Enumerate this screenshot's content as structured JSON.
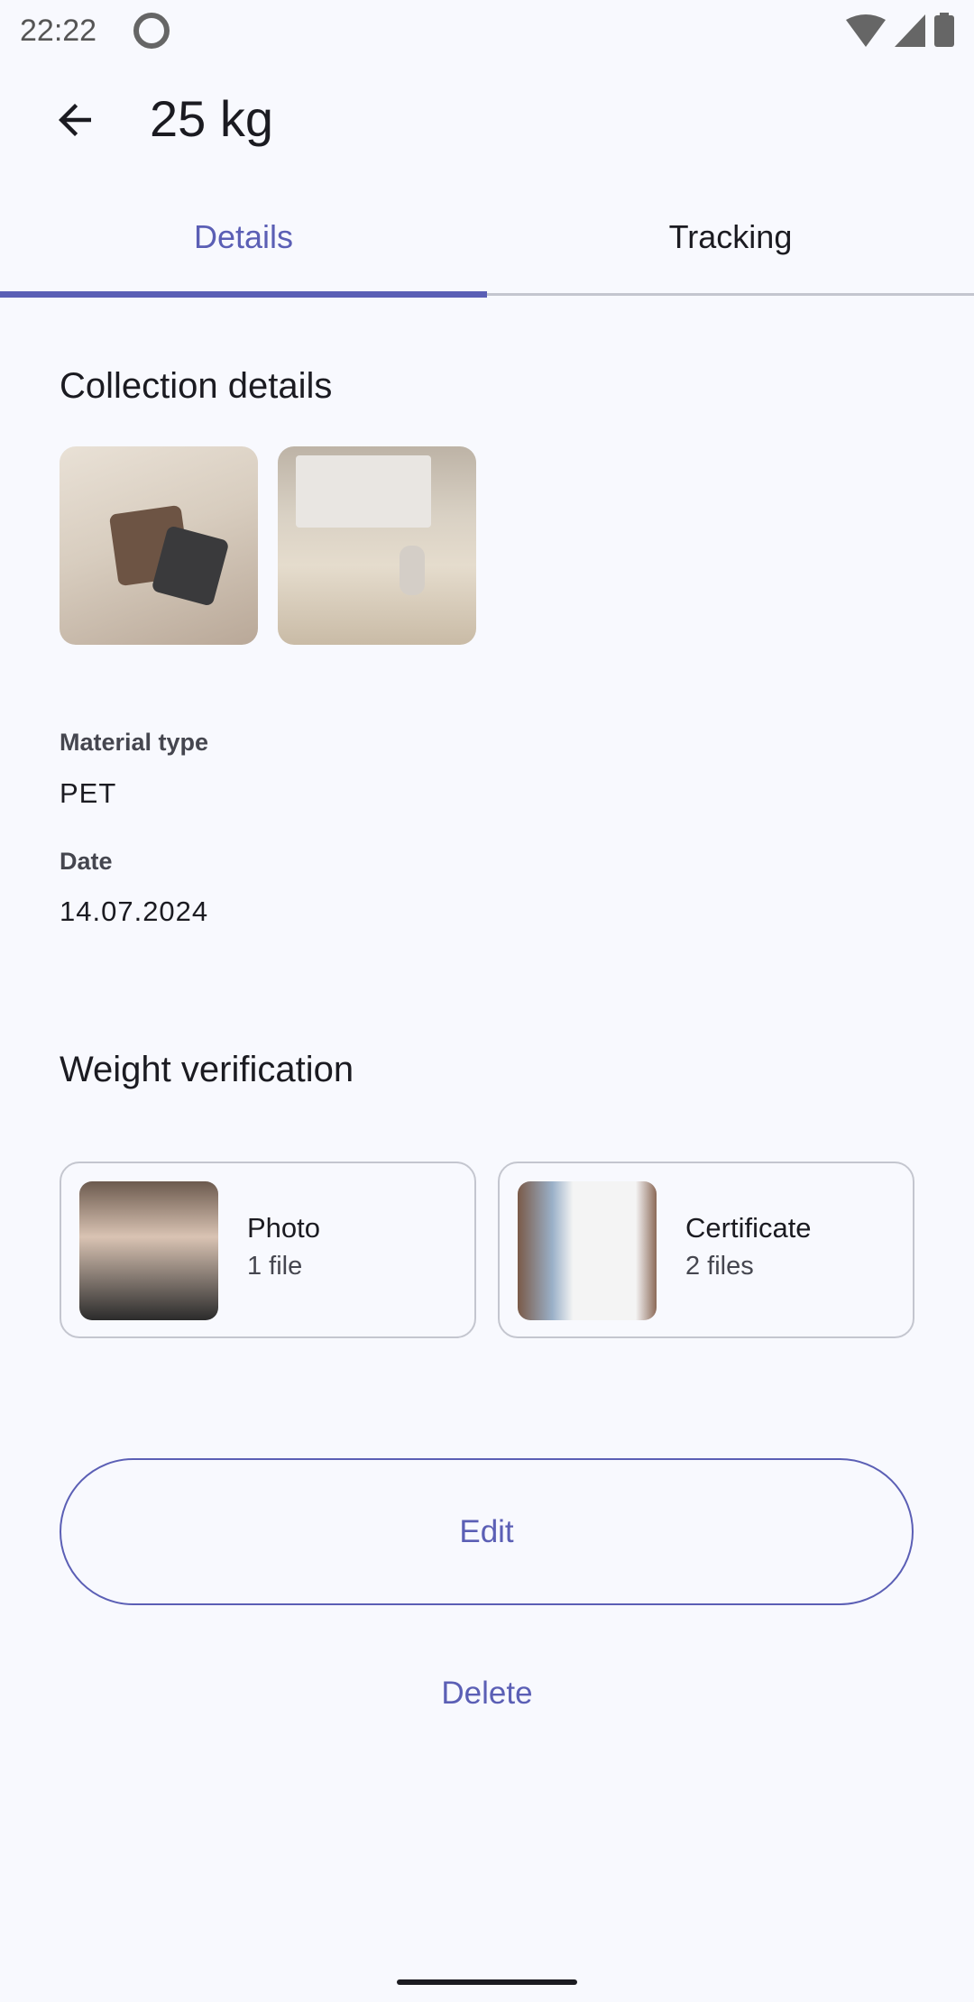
{
  "status_bar": {
    "time": "22:22"
  },
  "app_bar": {
    "title": "25 kg"
  },
  "tabs": [
    {
      "label": "Details",
      "selected": true
    },
    {
      "label": "Tracking",
      "selected": false
    }
  ],
  "collection": {
    "heading": "Collection details",
    "fields": [
      {
        "label": "Material type",
        "value": "PET"
      },
      {
        "label": "Date",
        "value": "14.07.2024"
      }
    ]
  },
  "verification": {
    "heading": "Weight verification",
    "cards": [
      {
        "title": "Photo",
        "subtitle": "1 file"
      },
      {
        "title": "Certificate",
        "subtitle": "2 files"
      }
    ]
  },
  "actions": {
    "edit": "Edit",
    "delete": "Delete"
  },
  "colors": {
    "accent": "#5b5fb5",
    "background": "#f8f9fe"
  }
}
